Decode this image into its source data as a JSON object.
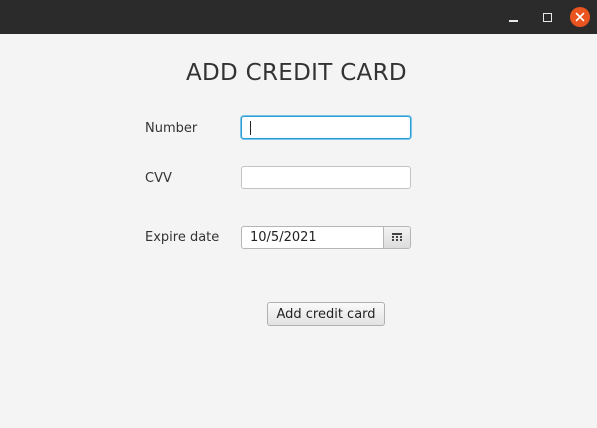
{
  "window": {
    "controls": {
      "minimize_icon": "minimize-icon",
      "maximize_icon": "maximize-icon",
      "close_icon": "close-icon",
      "close_color": "#e95420"
    }
  },
  "form": {
    "title": "ADD CREDIT CARD",
    "number_label": "Number",
    "number_value": "",
    "cvv_label": "CVV",
    "cvv_value": "",
    "expire_label": "Expire date",
    "expire_value": "10/5/2021",
    "calendar_icon": "calendar-icon",
    "submit_label": "Add credit card"
  },
  "colors": {
    "focus_border": "#2a9fd6",
    "background": "#f4f4f4",
    "titlebar": "#2b2b2b"
  }
}
